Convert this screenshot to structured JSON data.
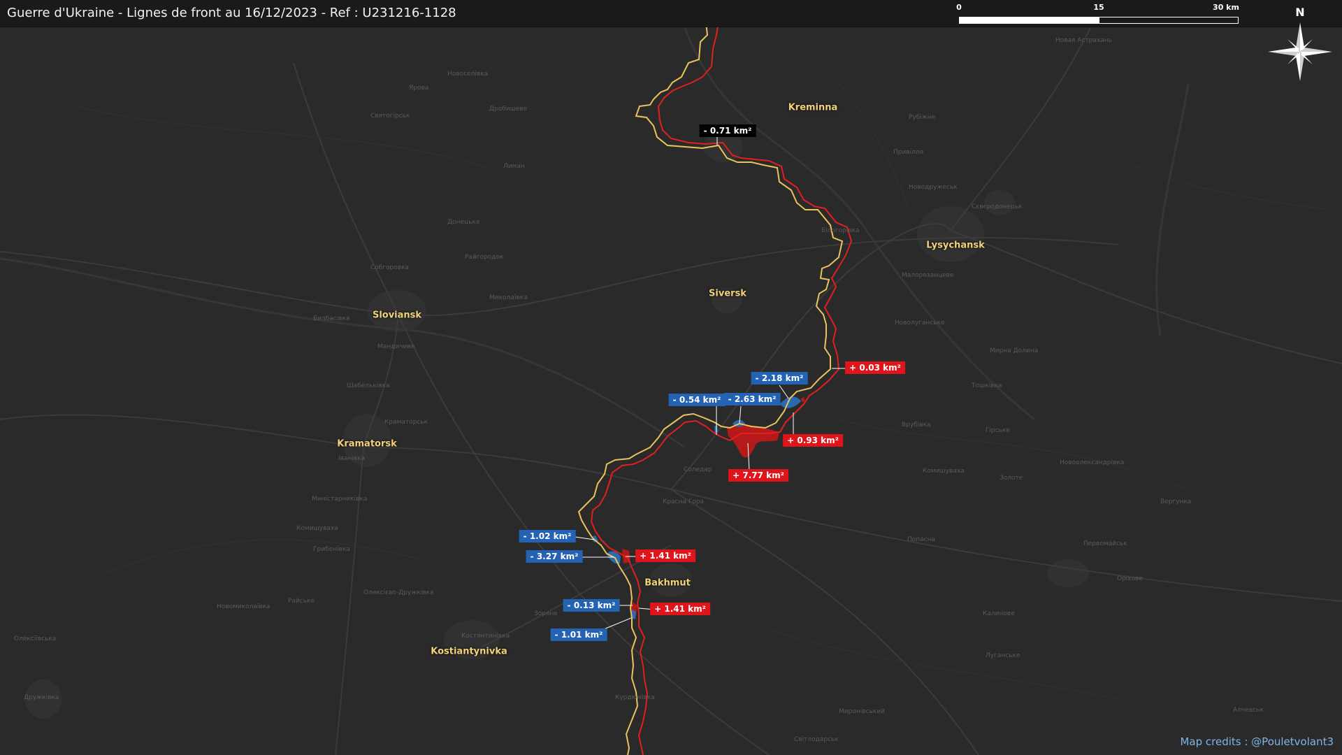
{
  "title": "Guerre d'Ukraine - Lignes de front au 16/12/2023 - Ref : U231216-1128",
  "scale_bar": {
    "ticks": [
      "0",
      "15",
      "30 km"
    ]
  },
  "compass": {
    "letter": "N",
    "icon": "north-arrow-icon"
  },
  "credit": "Map credits : @Pouletvolant3",
  "colors": {
    "background": "#2a2a2a",
    "front_line_new": "#e02020",
    "front_line_old": "#e8c45a",
    "gain_fill": "#c41818",
    "loss_fill": "#2c6db8",
    "city_label": "#f3d27a",
    "credit": "#7fb6e8"
  },
  "cities": [
    {
      "id": "kreminna",
      "name": "Kreminna"
    },
    {
      "id": "lysychansk",
      "name": "Lysychansk"
    },
    {
      "id": "siversk",
      "name": "Siversk"
    },
    {
      "id": "sloviansk",
      "name": "Sloviansk"
    },
    {
      "id": "kramatorsk",
      "name": "Kramatorsk"
    },
    {
      "id": "bakhmut",
      "name": "Bakhmut"
    },
    {
      "id": "kostiantynivka",
      "name": "Kostiantynivka"
    }
  ],
  "territory_changes": [
    {
      "id": "c1",
      "text": "- 0.71 km²",
      "kind": "neutral"
    },
    {
      "id": "c2",
      "text": "+ 0.03 km²",
      "kind": "gain"
    },
    {
      "id": "c3",
      "text": "- 2.18 km²",
      "kind": "loss"
    },
    {
      "id": "c4",
      "text": "- 0.54 km²",
      "kind": "loss"
    },
    {
      "id": "c5",
      "text": "- 2.63 km²",
      "kind": "loss"
    },
    {
      "id": "c6",
      "text": "+ 0.93 km²",
      "kind": "gain"
    },
    {
      "id": "c7",
      "text": "+ 7.77 km²",
      "kind": "gain"
    },
    {
      "id": "c8",
      "text": "- 1.02 km²",
      "kind": "loss"
    },
    {
      "id": "c9",
      "text": "- 3.27 km²",
      "kind": "loss"
    },
    {
      "id": "c10",
      "text": "+ 1.41 km²",
      "kind": "gain"
    },
    {
      "id": "c11",
      "text": "- 0.13 km²",
      "kind": "loss"
    },
    {
      "id": "c12",
      "text": "+ 1.41 km²",
      "kind": "gain"
    },
    {
      "id": "c13",
      "text": "- 1.01 km²",
      "kind": "loss"
    }
  ]
}
